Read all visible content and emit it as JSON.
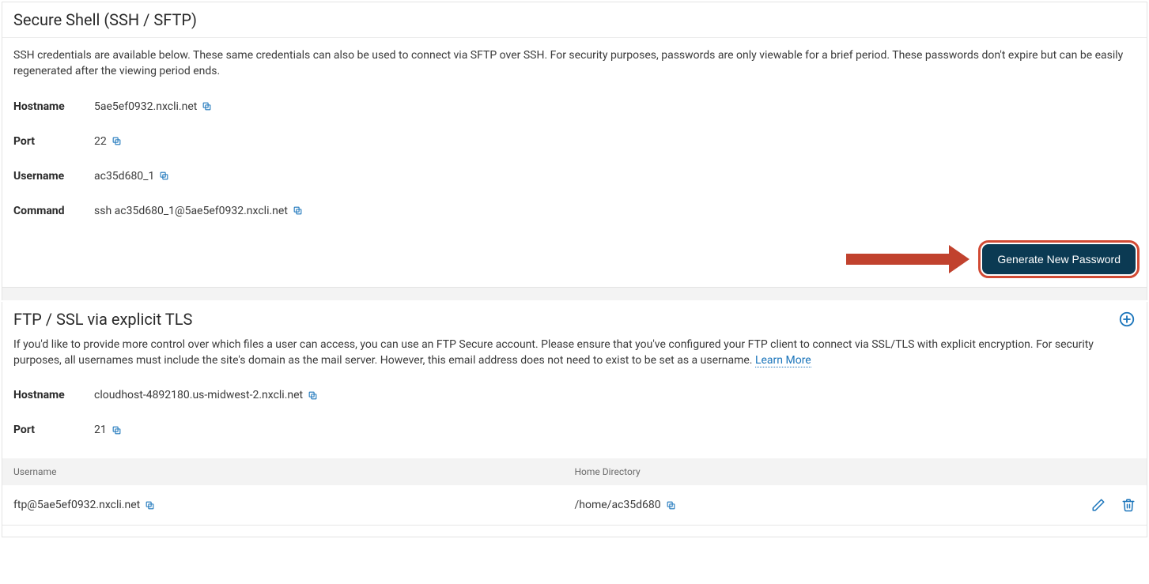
{
  "ssh": {
    "title": "Secure Shell (SSH / SFTP)",
    "description": "SSH credentials are available below. These same credentials can also be used to connect via SFTP over SSH. For security purposes, passwords are only viewable for a brief period. These passwords don't expire but can be easily regenerated after the viewing period ends.",
    "labels": {
      "hostname": "Hostname",
      "port": "Port",
      "username": "Username",
      "command": "Command"
    },
    "values": {
      "hostname": "5ae5ef0932.nxcli.net",
      "port": "22",
      "username": "ac35d680_1",
      "command": "ssh ac35d680_1@5ae5ef0932.nxcli.net"
    },
    "button": "Generate New Password"
  },
  "ftp": {
    "title": "FTP / SSL via explicit TLS",
    "description": "If you'd like to provide more control over which files a user can access, you can use an FTP Secure account. Please ensure that you've configured your FTP client to connect via SSL/TLS with explicit encryption. For security purposes, all usernames must include the site's domain as the mail server. However, this email address does not need to exist to be set as a username. ",
    "learn_more": "Learn More",
    "labels": {
      "hostname": "Hostname",
      "port": "Port"
    },
    "values": {
      "hostname": "cloudhost-4892180.us-midwest-2.nxcli.net",
      "port": "21"
    },
    "table": {
      "headers": {
        "username": "Username",
        "home": "Home Directory"
      },
      "rows": [
        {
          "username": "ftp@5ae5ef0932.nxcli.net",
          "home": "/home/ac35d680"
        }
      ]
    }
  }
}
